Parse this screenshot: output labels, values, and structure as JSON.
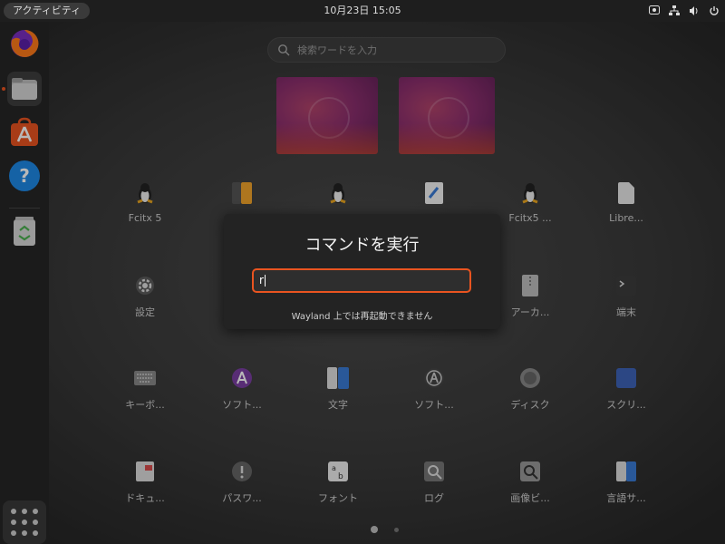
{
  "topbar": {
    "activities": "アクティビティ",
    "datetime": "10月23日  15:05",
    "tray_icons": [
      "screen-record-icon",
      "network-icon",
      "volume-icon",
      "power-icon"
    ]
  },
  "dock": {
    "items": [
      {
        "name": "firefox",
        "icon": "firefox-icon"
      },
      {
        "name": "files",
        "icon": "folder-icon",
        "running": true
      },
      {
        "name": "app-center",
        "icon": "app-store-icon"
      },
      {
        "name": "help",
        "icon": "help-icon",
        "glyph": "?"
      },
      {
        "name": "trash",
        "icon": "trash-icon"
      }
    ],
    "show_apps_icon": "apps-grid-icon"
  },
  "search": {
    "placeholder": "検索ワードを入力"
  },
  "apps": {
    "row1": [
      "Fcitx 5",
      "",
      "",
      "",
      "Fcitx5 ...",
      "Libre..."
    ],
    "row2": [
      "設定",
      "",
      "",
      "",
      "アーカ...",
      "端末"
    ],
    "row3": [
      "キーボ...",
      "ソフト...",
      "文字",
      "ソフト...",
      "ディスク",
      "スクリ..."
    ],
    "row4": [
      "ドキュ...",
      "パスワ...",
      "フォント",
      "ログ",
      "画像ビ...",
      "言語サ..."
    ]
  },
  "run_dialog": {
    "title": "コマンドを実行",
    "input_value": "r",
    "message": "Wayland 上では再起動できません"
  },
  "colors": {
    "accent": "#e95420"
  }
}
